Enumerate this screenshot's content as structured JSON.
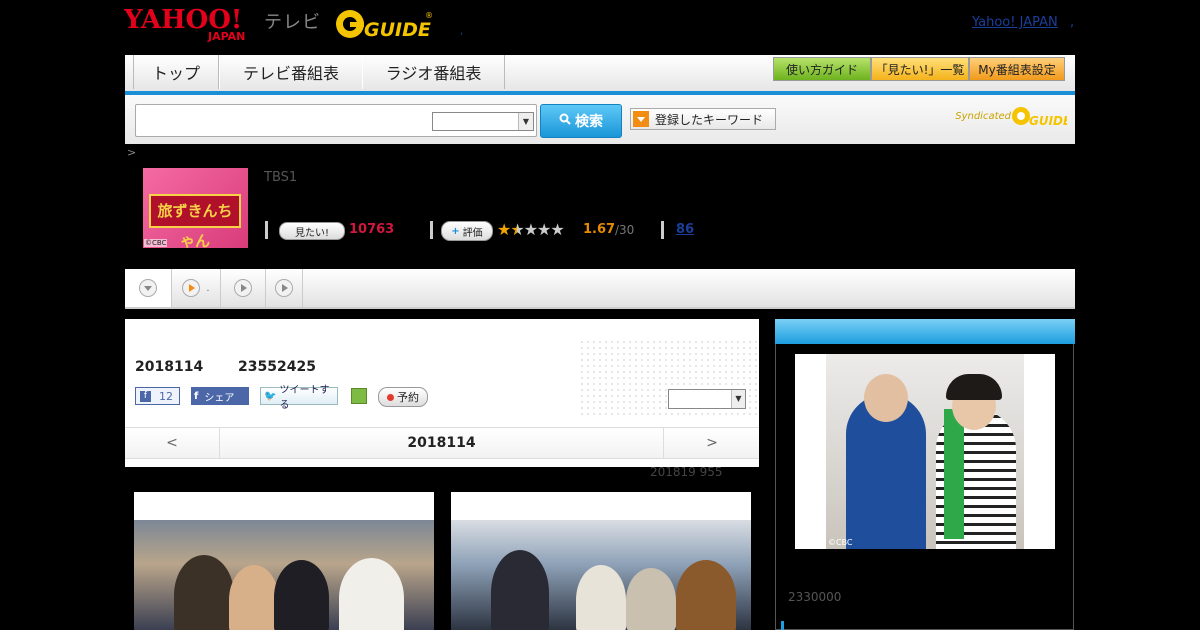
{
  "header": {
    "logo_yahoo": "YAHOO! JAPAN",
    "logo_tv": "テレビ",
    "logo_gguide": "G GUIDE",
    "yahoo_japan_link": "Yahoo! JAPAN",
    "dot": ","
  },
  "nav": {
    "tabs": [
      {
        "label": "トップ"
      },
      {
        "label": "テレビ番組表"
      },
      {
        "label": "ラジオ番組表"
      }
    ],
    "buttons": {
      "guide": "使い方ガイド",
      "mitai_list": "「見たい!」一覧",
      "my_schedule": "My番組表設定"
    }
  },
  "search": {
    "input_value": "",
    "select_value": "",
    "button_label": "検索",
    "keywords_label": "登録したキーワード",
    "syndicated": "Syndicated"
  },
  "breadcrumb": ">",
  "program": {
    "title_image": "旅ずきんちゃん",
    "thumb_copyright": "©CBC",
    "channel": "TBS1",
    "mitai_label": "見たい!",
    "mitai_count": "10763",
    "hyoka_label": "評価",
    "rating": "1.67",
    "rating_max": "/30",
    "review_count": "86"
  },
  "subtabs": {
    "dot": "."
  },
  "episode": {
    "date": "2018114",
    "time": "23552425",
    "like_count": "12",
    "share_label": "シェア",
    "tweet_label": "ツイートする",
    "reserve_label": "予約",
    "select_value": "",
    "nav_prev": "<",
    "nav_date": "2018114",
    "nav_next": ">",
    "update_note": "201819  955"
  },
  "side": {
    "photo_copyright": "©CBC",
    "note": "2330000"
  },
  "colors": {
    "accent_blue": "#1a8fd8",
    "mitai_red": "#d1173e",
    "rating_orange": "#e68a00",
    "link_blue": "#1a3e9a"
  }
}
